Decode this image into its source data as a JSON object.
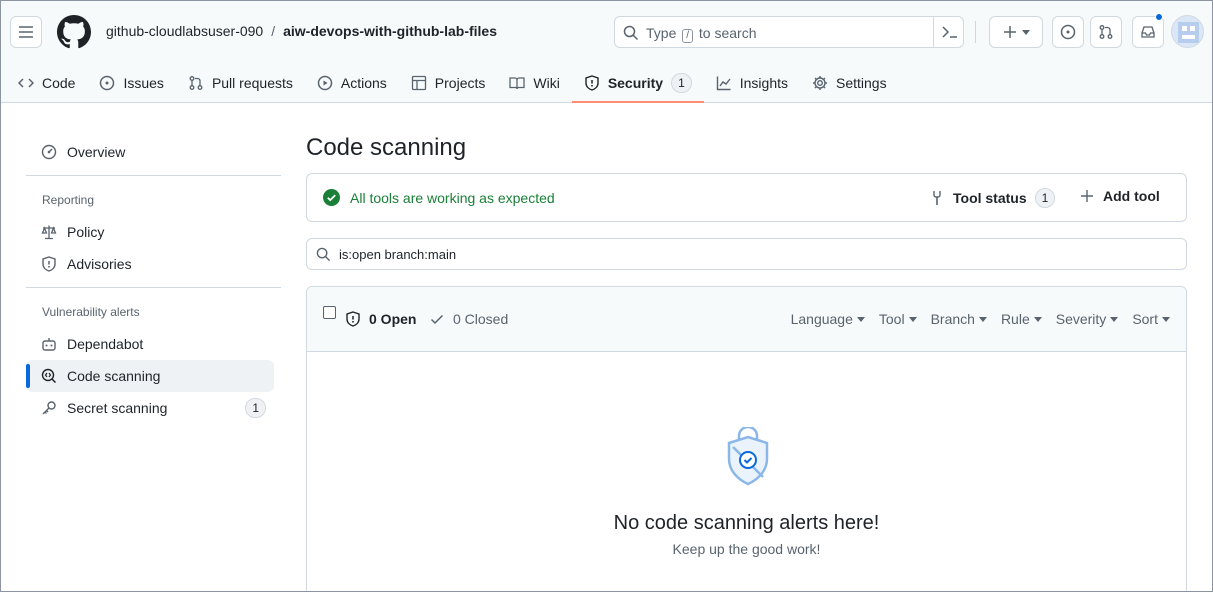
{
  "header": {
    "owner": "github-cloudlabsuser-090",
    "separator": "/",
    "repo": "aiw-devops-with-github-lab-files",
    "search_prefix": "Type",
    "search_key": "/",
    "search_suffix": "to search"
  },
  "nav": [
    {
      "label": "Code",
      "icon": "code-icon"
    },
    {
      "label": "Issues",
      "icon": "issue-opened-icon"
    },
    {
      "label": "Pull requests",
      "icon": "git-pull-request-icon"
    },
    {
      "label": "Actions",
      "icon": "play-icon"
    },
    {
      "label": "Projects",
      "icon": "table-icon"
    },
    {
      "label": "Wiki",
      "icon": "book-icon"
    },
    {
      "label": "Security",
      "icon": "shield-icon",
      "count": "1",
      "selected": true
    },
    {
      "label": "Insights",
      "icon": "graph-icon"
    },
    {
      "label": "Settings",
      "icon": "gear-icon"
    }
  ],
  "sidebar": {
    "overview": "Overview",
    "reporting_heading": "Reporting",
    "policy": "Policy",
    "advisories": "Advisories",
    "vuln_heading": "Vulnerability alerts",
    "dependabot": "Dependabot",
    "code_scanning": "Code scanning",
    "secret_scanning": "Secret scanning",
    "secret_scanning_count": "1"
  },
  "main": {
    "title": "Code scanning",
    "tools_ok": "All tools are working as expected",
    "tool_status": "Tool status",
    "tool_status_count": "1",
    "add_tool": "Add tool",
    "filter_value": "is:open branch:main",
    "open_label": "0 Open",
    "closed_label": "0 Closed",
    "filters": [
      "Language",
      "Tool",
      "Branch",
      "Rule",
      "Severity",
      "Sort"
    ],
    "blank_title": "No code scanning alerts here!",
    "blank_sub": "Keep up the good work!"
  },
  "colors": {
    "accent": "#0969da",
    "success": "#1a7f37",
    "selected_underline": "#fd8c73"
  }
}
